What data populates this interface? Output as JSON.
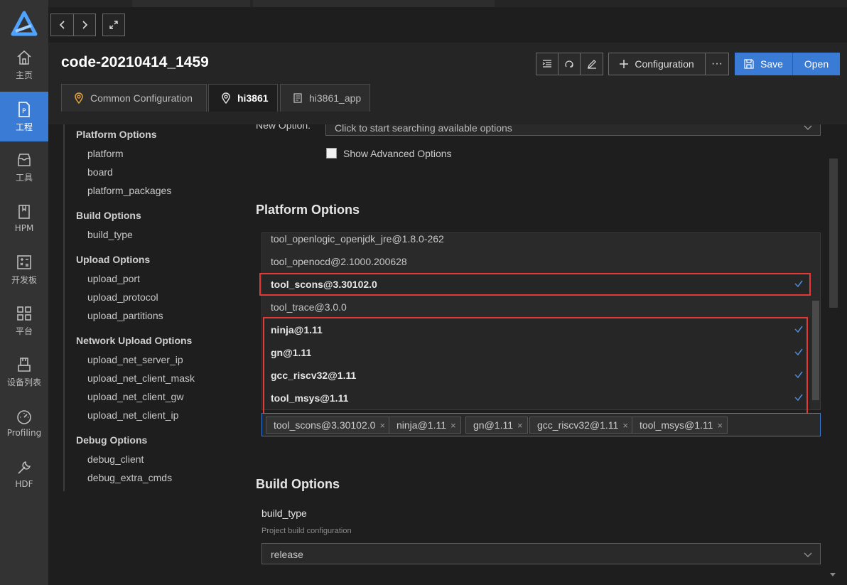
{
  "activity_bar": {
    "items": [
      {
        "label": "主页",
        "icon": "home-icon"
      },
      {
        "label": "工程",
        "icon": "project-icon"
      },
      {
        "label": "工具",
        "icon": "tools-icon"
      },
      {
        "label": "HPM",
        "icon": "hpm-icon"
      },
      {
        "label": "开发板",
        "icon": "board-icon"
      },
      {
        "label": "平台",
        "icon": "platform-icon"
      },
      {
        "label": "设备列表",
        "icon": "device-list-icon"
      },
      {
        "label": "Profiling",
        "icon": "profiling-icon"
      },
      {
        "label": "HDF",
        "icon": "hdf-icon"
      }
    ]
  },
  "header": {
    "title": "code-20210414_1459",
    "config_label": "Configuration",
    "more_label": "···",
    "save_label": "Save",
    "open_label": "Open"
  },
  "tabs": [
    {
      "label": "Common Configuration"
    },
    {
      "label": "hi3861"
    },
    {
      "label": "hi3861_app"
    }
  ],
  "sidenav": {
    "groups": [
      {
        "title": "Platform Options",
        "items": [
          "platform",
          "board",
          "platform_packages"
        ]
      },
      {
        "title": "Build Options",
        "items": [
          "build_type"
        ]
      },
      {
        "title": "Upload Options",
        "items": [
          "upload_port",
          "upload_protocol",
          "upload_partitions"
        ]
      },
      {
        "title": "Network Upload Options",
        "items": [
          "upload_net_server_ip",
          "upload_net_client_mask",
          "upload_net_client_gw",
          "upload_net_client_ip"
        ]
      },
      {
        "title": "Debug Options",
        "items": [
          "debug_client",
          "debug_extra_cmds"
        ]
      }
    ]
  },
  "main": {
    "new_option_label": "New Option:",
    "new_option_placeholder": "Click to start searching available options",
    "show_advanced_label": "Show Advanced Options",
    "platform_options_title": "Platform Options",
    "options_list": [
      {
        "label": "tool_openlogic_openjdk_jre@1.8.0-262",
        "selected": false
      },
      {
        "label": "tool_openocd@2.1000.200628",
        "selected": false
      },
      {
        "label": "tool_scons@3.30102.0",
        "selected": true
      },
      {
        "label": "tool_trace@3.0.0",
        "selected": false
      },
      {
        "label": "ninja@1.11",
        "selected": true
      },
      {
        "label": "gn@1.11",
        "selected": true
      },
      {
        "label": "gcc_riscv32@1.11",
        "selected": true
      },
      {
        "label": "tool_msys@1.11",
        "selected": true
      }
    ],
    "selected_tags": [
      "tool_scons@3.30102.0",
      "ninja@1.11",
      "gn@1.11",
      "gcc_riscv32@1.11",
      "tool_msys@1.11"
    ],
    "tag_remove": "×",
    "build_options_title": "Build Options",
    "build_type_label": "build_type",
    "build_type_help": "Project build configuration",
    "build_type_value": "release"
  },
  "colors": {
    "accent": "#3a7bd5",
    "highlight": "#e53935",
    "tab_location_icon": "#e8a33d"
  }
}
